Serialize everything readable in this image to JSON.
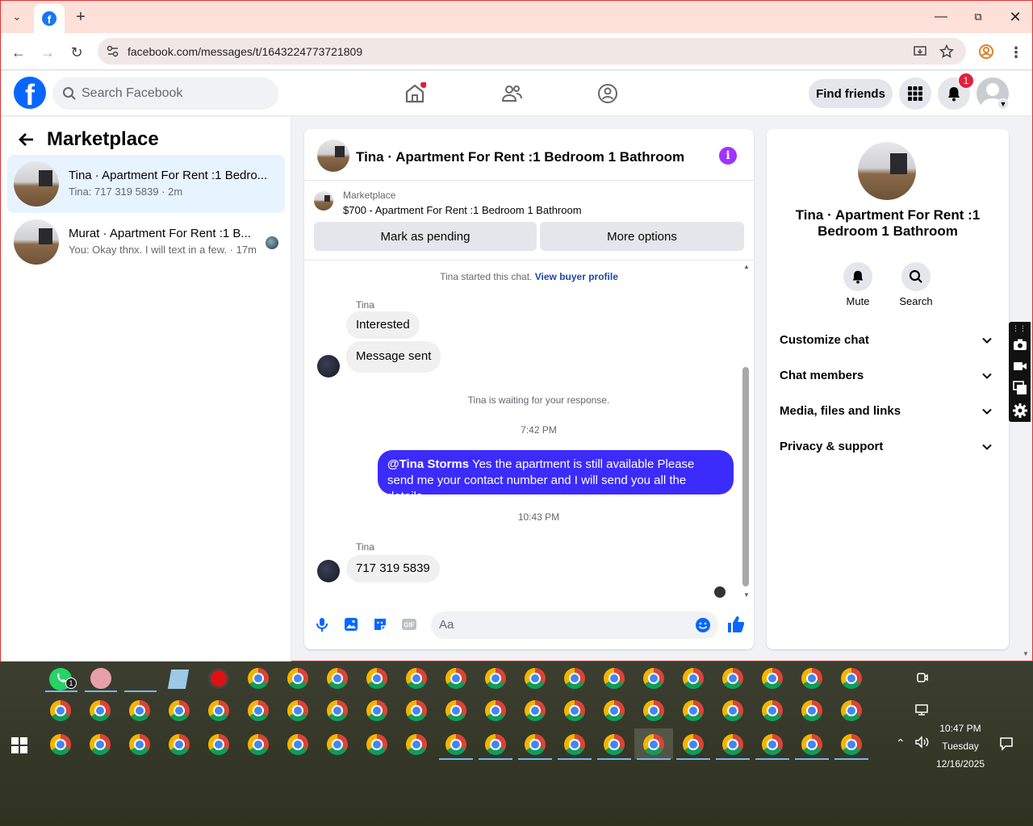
{
  "browser": {
    "tab_icon": "facebook-icon",
    "new_tab_label": "+",
    "url": "facebook.com/messages/t/1643224773721809"
  },
  "fb": {
    "search_placeholder": "Search Facebook",
    "find_friends": "Find friends",
    "notification_count": "1"
  },
  "left": {
    "title": "Marketplace",
    "conversations": [
      {
        "title": "Tina · Apartment For Rent :1 Bedro...",
        "snippet": "Tina: 717 319 5839 · 2m"
      },
      {
        "title": "Murat · Apartment For Rent :1 B...",
        "snippet": "You: Okay thnx. I will text in a few. · 17m"
      }
    ]
  },
  "chat": {
    "title": "Tina · Apartment For Rent :1 Bedroom 1 Bathroom",
    "marketplace_label": "Marketplace",
    "listing": "$700 - Apartment For Rent :1 Bedroom 1 Bathroom",
    "mark_pending": "Mark as pending",
    "more_options": "More options",
    "started_text": "Tina started this chat.",
    "view_profile": "View buyer profile",
    "sender1": "Tina",
    "msg_interested": "Interested",
    "msg_sent": "Message sent",
    "waiting": "Tina is waiting for your response.",
    "time1": "7:42 PM",
    "my_mention": "@Tina Storms",
    "my_msg": "Yes the apartment is still available Please send me your contact number and I will send you all the details",
    "time2": "10:43 PM",
    "sender2": "Tina",
    "msg_number": "717 319 5839",
    "composer_placeholder": "Aa"
  },
  "right": {
    "name": "Tina · Apartment For Rent :1 Bedroom 1 Bathroom",
    "mute": "Mute",
    "search": "Search",
    "sections": [
      "Customize chat",
      "Chat members",
      "Media, files and links",
      "Privacy & support"
    ]
  },
  "taskbar": {
    "time": "10:47 PM",
    "day": "Tuesday",
    "date": "12/16/2025",
    "whatsapp_badge": "1"
  },
  "colors": {
    "fb_blue": "#0866ff",
    "my_bubble": "#3c2cfb",
    "info_purple": "#a033ff",
    "badge_red": "#e41e3f",
    "tabbar": "#fde0d8"
  }
}
